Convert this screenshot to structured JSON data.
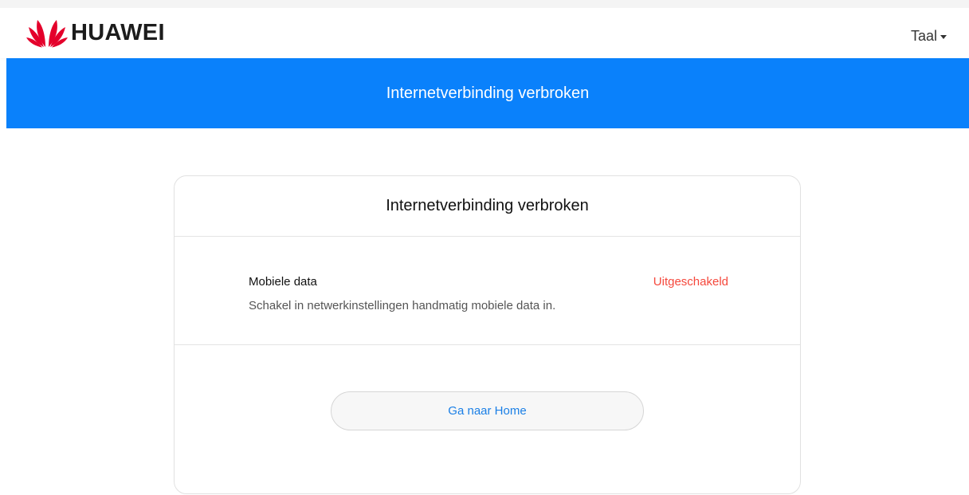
{
  "header": {
    "logo_text": "HUAWEI",
    "language_label": "Taal",
    "brand_color": "#E4002B"
  },
  "banner": {
    "title": "Internetverbinding verbroken",
    "color": "#0A81FB"
  },
  "card": {
    "title": "Internetverbinding verbroken",
    "item": {
      "label": "Mobiele data",
      "status": "Uitgeschakeld",
      "status_color": "#F5483C",
      "description": "Schakel in netwerkinstellingen handmatig mobiele data in."
    },
    "button_label": "Ga naar Home"
  }
}
